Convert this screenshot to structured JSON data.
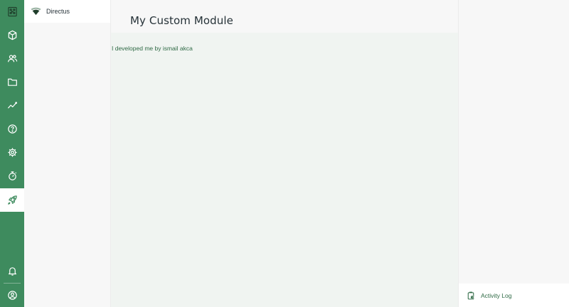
{
  "colors": {
    "accent": "#3e8b5e",
    "text_dark": "#263238",
    "text_green": "#2f6a45",
    "content_bg": "#f0f4f1"
  },
  "module_bar": {
    "items": [
      {
        "icon": "directus-logo-icon"
      },
      {
        "icon": "box-icon"
      },
      {
        "icon": "users-icon"
      },
      {
        "icon": "folder-icon"
      },
      {
        "icon": "insights-icon"
      },
      {
        "icon": "help-icon"
      },
      {
        "icon": "settings-icon"
      },
      {
        "icon": "touch-icon"
      },
      {
        "icon": "rocket-icon",
        "active": true
      },
      {
        "icon": "bell-icon"
      },
      {
        "icon": "account-icon"
      }
    ]
  },
  "nav": {
    "project_name": "Directus",
    "logo_icon": "wifi-logo-icon"
  },
  "header": {
    "title": "My Custom Module"
  },
  "main": {
    "text": "I developed me by ismail akca"
  },
  "sidebar": {
    "activity_label": "Activity Log",
    "activity_icon": "activity-log-icon"
  }
}
